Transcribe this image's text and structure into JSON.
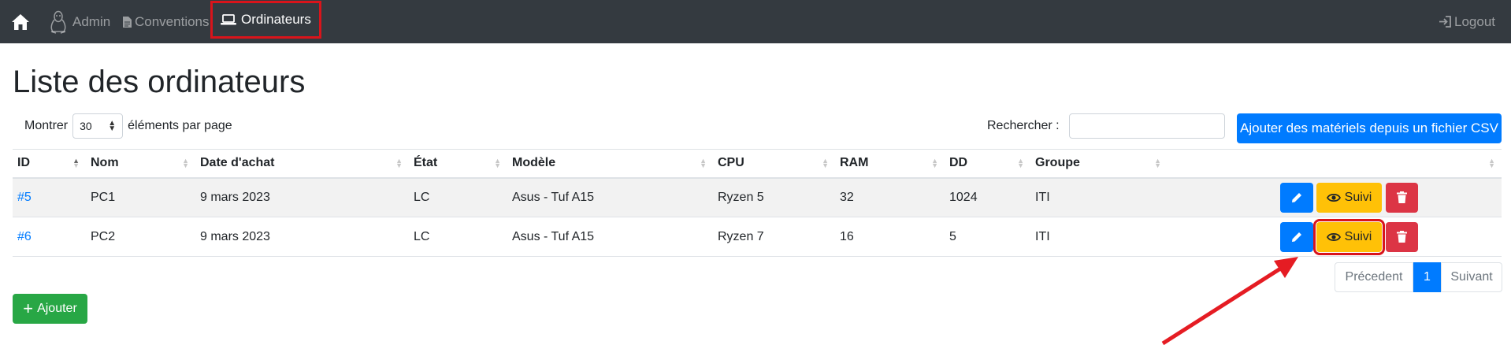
{
  "navbar": {
    "home_icon": "home-icon",
    "admin_label": "Admin",
    "admin_icon": "linux-tux-icon",
    "conventions_label": "Conventions",
    "conventions_icon": "file-icon",
    "ordinateurs_label": "Ordinateurs",
    "ordinateurs_icon": "laptop-icon",
    "logout_label": "Logout",
    "logout_icon": "logout-icon"
  },
  "page": {
    "title": "Liste des ordinateurs"
  },
  "length_control": {
    "prefix": "Montrer",
    "value": "30",
    "suffix": "éléments par page"
  },
  "search": {
    "label": "Rechercher :",
    "value": "",
    "placeholder": ""
  },
  "csv_button_label": "Ajouter des matériels depuis un fichier CSV",
  "table": {
    "columns": [
      "ID",
      "Nom",
      "Date d'achat",
      "État",
      "Modèle",
      "CPU",
      "RAM",
      "DD",
      "Groupe",
      ""
    ],
    "rows": [
      {
        "id": "#5",
        "nom": "PC1",
        "date": "9 mars 2023",
        "etat": "LC",
        "modele": "Asus - Tuf A15",
        "cpu": "Ryzen 5",
        "ram": "32",
        "dd": "1024",
        "groupe": "ITI",
        "suivi_label": "Suivi"
      },
      {
        "id": "#6",
        "nom": "PC2",
        "date": "9 mars 2023",
        "etat": "LC",
        "modele": "Asus - Tuf A15",
        "cpu": "Ryzen 7",
        "ram": "16",
        "dd": "5",
        "groupe": "ITI",
        "suivi_label": "Suivi"
      }
    ]
  },
  "pagination": {
    "prev": "Précedent",
    "current": "1",
    "next": "Suivant"
  },
  "add_button_label": "Ajouter",
  "colors": {
    "navbar": "#343a40",
    "primary": "#007bff",
    "warning": "#ffc107",
    "danger": "#dc3545",
    "success": "#28a745",
    "highlight": "#d9141b"
  }
}
